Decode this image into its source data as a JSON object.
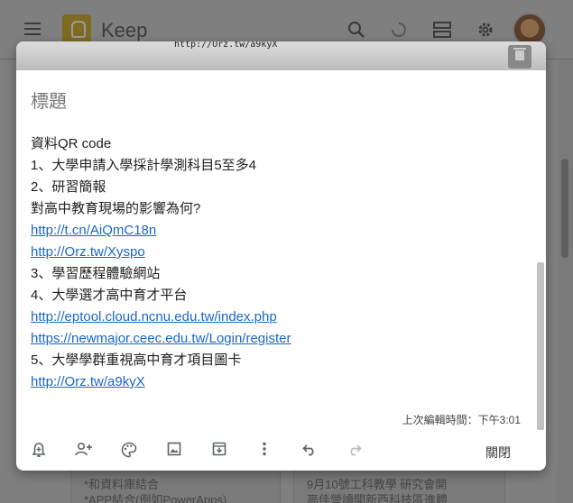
{
  "app": {
    "title": "Keep"
  },
  "background_cards": {
    "left_lines": [
      "*和資料庫結合",
      "*APP結合(例如PowerApps)"
    ],
    "right_lines": [
      "9月10號工科教學 研究會開",
      "高佳營讀開新西科技區進體"
    ]
  },
  "note": {
    "image_caption": "http://Orz.tw/a9kyX",
    "title_placeholder": "標題",
    "lines": [
      {
        "text": "資料QR code",
        "link": false
      },
      {
        "text": "1、大學申請入學採計學測科目5至多4",
        "link": false
      },
      {
        "text": "2、研習簡報",
        "link": false
      },
      {
        "text": "對高中教育現場的影響為何?",
        "link": false
      },
      {
        "text": "http://t.cn/AiQmC18n",
        "link": true
      },
      {
        "text": "http://Orz.tw/Xyspo",
        "link": true
      },
      {
        "text": "3、學習歷程體驗網站",
        "link": false
      },
      {
        "text": "4、大學選才高中育才平台",
        "link": false
      },
      {
        "text": "http://eptool.cloud.ncnu.edu.tw/index.php",
        "link": true
      },
      {
        "text": "https://newmajor.ceec.edu.tw/Login/register",
        "link": true
      },
      {
        "text": "5、大學學群重視高中育才項目圖卡",
        "link": false
      },
      {
        "text": "http://Orz.tw/a9kyX",
        "link": true
      }
    ],
    "edited": "上次編輯時間：下午3:01",
    "close_label": "關閉"
  },
  "icons": {
    "menu": "menu-icon",
    "search": "search-icon",
    "refresh": "refresh-icon",
    "list_view": "list-view-icon",
    "settings": "gear-icon",
    "reminder": "bell-plus-icon",
    "collaborator": "person-add-icon",
    "color": "palette-icon",
    "image": "image-icon",
    "archive": "archive-icon",
    "more": "more-vert-icon",
    "undo": "undo-icon",
    "redo": "redo-icon"
  },
  "colors": {
    "link": "#1a66c9",
    "text": "#202124",
    "muted": "#757575"
  }
}
